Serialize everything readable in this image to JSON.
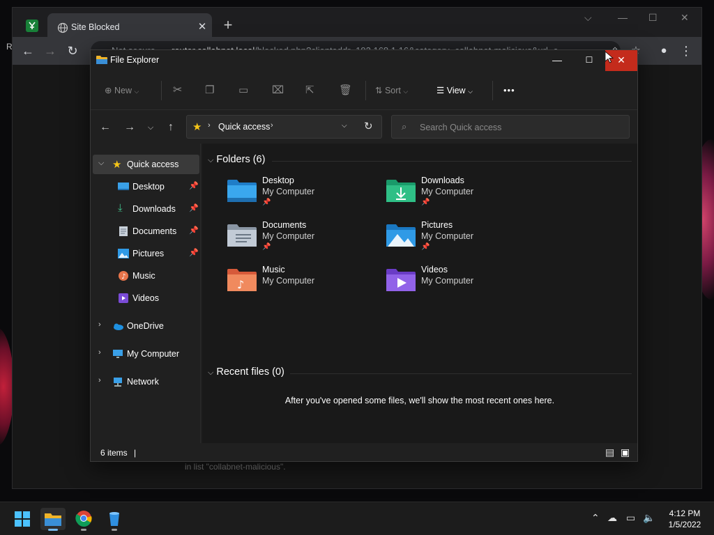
{
  "browser": {
    "tab_title": "Site Blocked",
    "tab_close": "✕",
    "new_tab": "+",
    "not_secure": "Not secure",
    "url_host": "router.collabnet.local",
    "url_path": "/blocked.php?clientaddr=192.168.1.16&category=collabnet-malicious&url=c",
    "page_fragment_left": "R",
    "page_fragment_bottom": "in list \"collabnet-malicious\"."
  },
  "explorer": {
    "title": "File Explorer",
    "commands": {
      "new": "New",
      "sort": "Sort",
      "view": "View",
      "more": "•••"
    },
    "address": {
      "location": "Quick access"
    },
    "search": {
      "placeholder": "Search Quick access"
    },
    "nav": {
      "quick_access": "Quick access",
      "items": [
        {
          "label": "Desktop",
          "pinned": true
        },
        {
          "label": "Downloads",
          "pinned": true
        },
        {
          "label": "Documents",
          "pinned": true
        },
        {
          "label": "Pictures",
          "pinned": true
        },
        {
          "label": "Music",
          "pinned": false
        },
        {
          "label": "Videos",
          "pinned": false
        }
      ],
      "onedrive": "OneDrive",
      "my_computer": "My Computer",
      "network": "Network"
    },
    "folders_section": "Folders (6)",
    "folders": [
      {
        "name": "Desktop",
        "location": "My Computer",
        "pinned": true
      },
      {
        "name": "Downloads",
        "location": "My Computer",
        "pinned": true
      },
      {
        "name": "Documents",
        "location": "My Computer",
        "pinned": true
      },
      {
        "name": "Pictures",
        "location": "My Computer",
        "pinned": true
      },
      {
        "name": "Music",
        "location": "My Computer",
        "pinned": false
      },
      {
        "name": "Videos",
        "location": "My Computer",
        "pinned": false
      }
    ],
    "recent_section": "Recent files (0)",
    "recent_empty": "After you've opened some files, we'll show the most recent ones here.",
    "status": "6 items"
  },
  "taskbar": {
    "time": "4:12 PM",
    "date": "1/5/2022"
  }
}
